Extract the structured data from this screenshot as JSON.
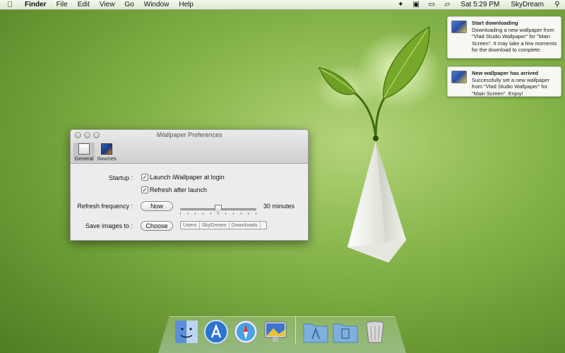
{
  "menubar": {
    "apple_icon": "apple-icon",
    "items": [
      "Finder",
      "File",
      "Edit",
      "View",
      "Go",
      "Window",
      "Help"
    ],
    "clock": "Sat 5:29 PM",
    "user": "SkyDream",
    "status_icons": [
      "script-icon",
      "iwallpaper-icon",
      "display-icon",
      "airplay-icon"
    ]
  },
  "notifications": [
    {
      "title": "Start downloading",
      "body": "Downloading a new wallpaper from \"Vlad Studio Wallpaper\" for \"Main Screen\". It may take a few moments for the download to complete."
    },
    {
      "title": "New wallpaper has arrived",
      "body": "Successfully set a new wallpaper from \"Vlad Studio Wallpaper\" for \"Main Screen\". Enjoy!"
    }
  ],
  "window": {
    "title": "iWallpaper Preferences",
    "toolbar": [
      {
        "label": "General",
        "icon": "general-icon"
      },
      {
        "label": "Sources",
        "icon": "sources-icon"
      }
    ],
    "startup_label": "Startup :",
    "launch_login_label": "Launch iWallpaper at login",
    "launch_login_checked": true,
    "refresh_launch_label": "Refresh after launch",
    "refresh_launch_checked": true,
    "refresh_frequency_label": "Refresh frequency :",
    "now_button": "Now",
    "refresh_minutes": 30,
    "slider_min_minutes": 0,
    "slider_max_minutes": 60,
    "refresh_value_label": "30 minutes",
    "save_images_label": "Save images to :",
    "choose_button": "Choose",
    "path": [
      "Users",
      "SkyDream",
      "Downloads"
    ]
  },
  "dock": {
    "items": [
      "finder-icon",
      "app-store-icon",
      "safari-icon",
      "iwallpaper-icon",
      "applications-folder-icon",
      "documents-folder-icon",
      "trash-icon"
    ]
  },
  "colors": {
    "desktop": "#8ab84f",
    "window_bg": "#ececec",
    "menubar": "#e8eedf"
  }
}
